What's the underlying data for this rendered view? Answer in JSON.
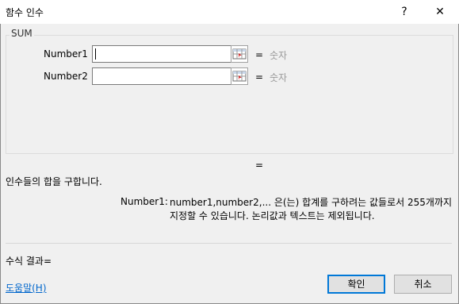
{
  "window": {
    "title": "함수 인수",
    "help_glyph": "?",
    "close_glyph": "✕"
  },
  "function_group": {
    "name": "SUM",
    "args": [
      {
        "label": "Number1",
        "value": "",
        "equals": "=",
        "hint": "숫자"
      },
      {
        "label": "Number2",
        "value": "",
        "equals": "=",
        "hint": "숫자"
      }
    ]
  },
  "result_equals": "=",
  "description": "인수들의 합을 구합니다.",
  "arg_help": {
    "label": "Number1:",
    "text": "number1,number2,... 은(는) 합계를 구하려는 값들로서 255개까지 지정할 수 있습니다. 논리값과 텍스트는 제외됩니다."
  },
  "formula_result": "수식 결과=",
  "help_link": "도움말(H)",
  "buttons": {
    "ok": "확인",
    "cancel": "취소"
  },
  "icons": {
    "range_select": "range-select-icon"
  }
}
